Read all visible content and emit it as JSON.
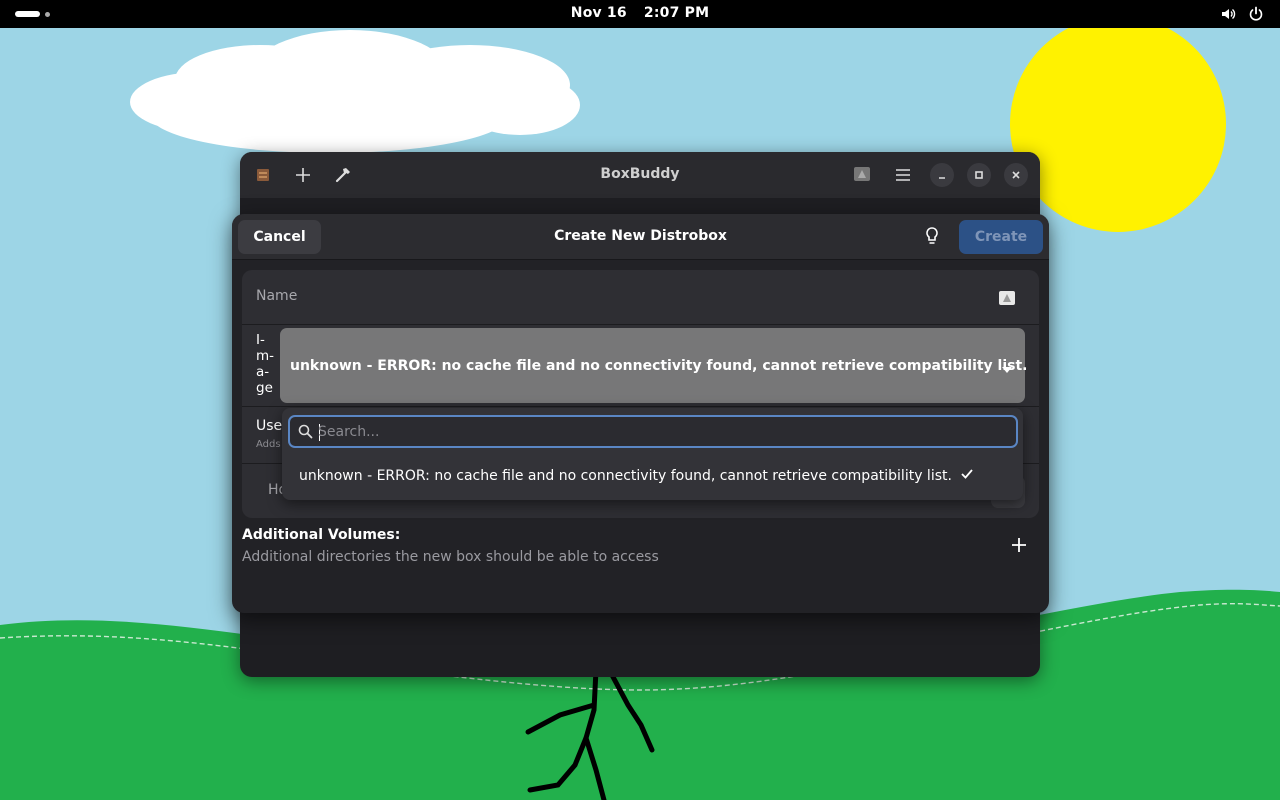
{
  "topbar": {
    "date": "Nov 16",
    "time": "2:07 PM",
    "icons": [
      "activities-indicator",
      "volume-icon",
      "power-icon"
    ]
  },
  "app_window": {
    "title": "BoxBuddy",
    "icons": [
      "boxbuddy-logo-icon",
      "plus-icon",
      "hammer-icon",
      "emoji-icon",
      "menu-icon",
      "minimize-icon",
      "maximize-icon",
      "close-icon"
    ]
  },
  "dialog": {
    "title": "Create New Distrobox",
    "cancel_label": "Cancel",
    "create_label": "Create",
    "name_label": "Name",
    "image_label": "Image",
    "image_value": "unknown - ERROR: no cache file and no connectivity found, cannot retrieve compatibility list.",
    "user_label": "Use",
    "user_sub": "Adds",
    "home_label": "Ho",
    "volumes_title": "Additional Volumes:",
    "volumes_sub": "Additional directories the new box should be able to access"
  },
  "popover": {
    "search_placeholder": "Search...",
    "options": [
      {
        "label": "unknown - ERROR: no cache file and no connectivity found, cannot retrieve compatibility list.",
        "selected": true
      }
    ]
  },
  "colors": {
    "accent": "#5a86c4",
    "create_button": "#2c5186",
    "dropdown_bg": "#777778",
    "sky": "#9dd5e6",
    "grass": "#22b04c",
    "sun": "#fff200"
  }
}
